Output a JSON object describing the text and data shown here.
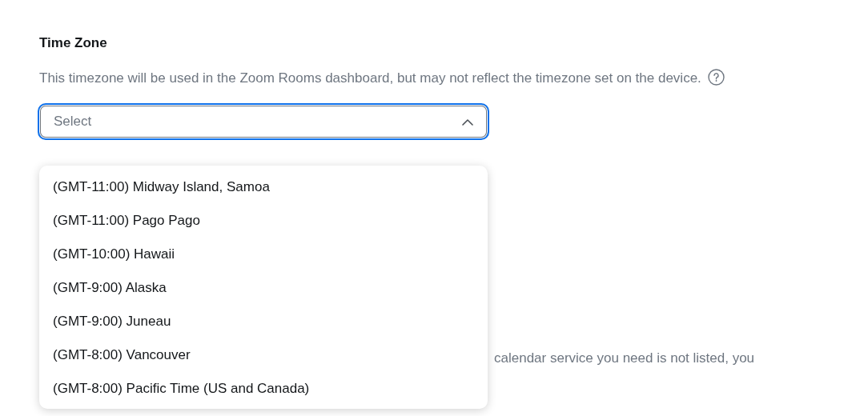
{
  "section": {
    "title": "Time Zone",
    "description": "This timezone will be used in the Zoom Rooms dashboard, but may not reflect the timezone set on the device."
  },
  "select": {
    "placeholder": "Select",
    "expanded": true
  },
  "options": [
    {
      "label": "(GMT-11:00) Midway Island, Samoa",
      "selected": false
    },
    {
      "label": "(GMT-11:00) Pago Pago",
      "selected": false
    },
    {
      "label": "(GMT-10:00) Hawaii",
      "selected": false
    },
    {
      "label": "(GMT-9:00) Alaska",
      "selected": false
    },
    {
      "label": "(GMT-9:00) Juneau",
      "selected": false
    },
    {
      "label": "(GMT-8:00) Vancouver",
      "selected": false
    },
    {
      "label": "(GMT-8:00) Pacific Time (US and Canada)",
      "selected": false
    }
  ],
  "calendar_note": {
    "line_1": "calendar service you need is not listed, you"
  }
}
